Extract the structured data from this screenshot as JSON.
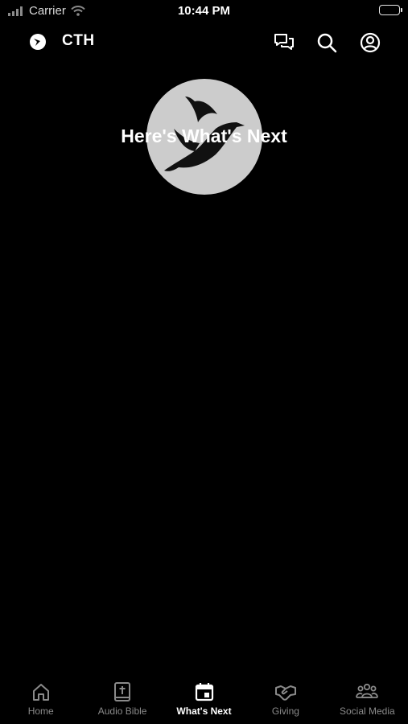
{
  "status_bar": {
    "carrier": "Carrier",
    "time": "10:44 PM",
    "icons": [
      "signal-icon",
      "wifi-icon",
      "battery-icon"
    ]
  },
  "header": {
    "title": "CTH",
    "icons": [
      "logo-icon",
      "chat-icon",
      "search-icon",
      "account-icon"
    ]
  },
  "hero": {
    "title": "Here's What's Next",
    "icon": "dove-icon",
    "circle_color": "#cccccc"
  },
  "tabs": [
    {
      "label": "Home",
      "icon": "home-icon",
      "active": false
    },
    {
      "label": "Audio Bible",
      "icon": "bible-icon",
      "active": false
    },
    {
      "label": "What's Next",
      "icon": "calendar-icon",
      "active": true
    },
    {
      "label": "Giving",
      "icon": "handshake-icon",
      "active": false
    },
    {
      "label": "Social Media",
      "icon": "people-icon",
      "active": false
    }
  ],
  "colors": {
    "background": "#000000",
    "active_tab": "#ffffff",
    "inactive_tab": "#8a8a8a"
  }
}
